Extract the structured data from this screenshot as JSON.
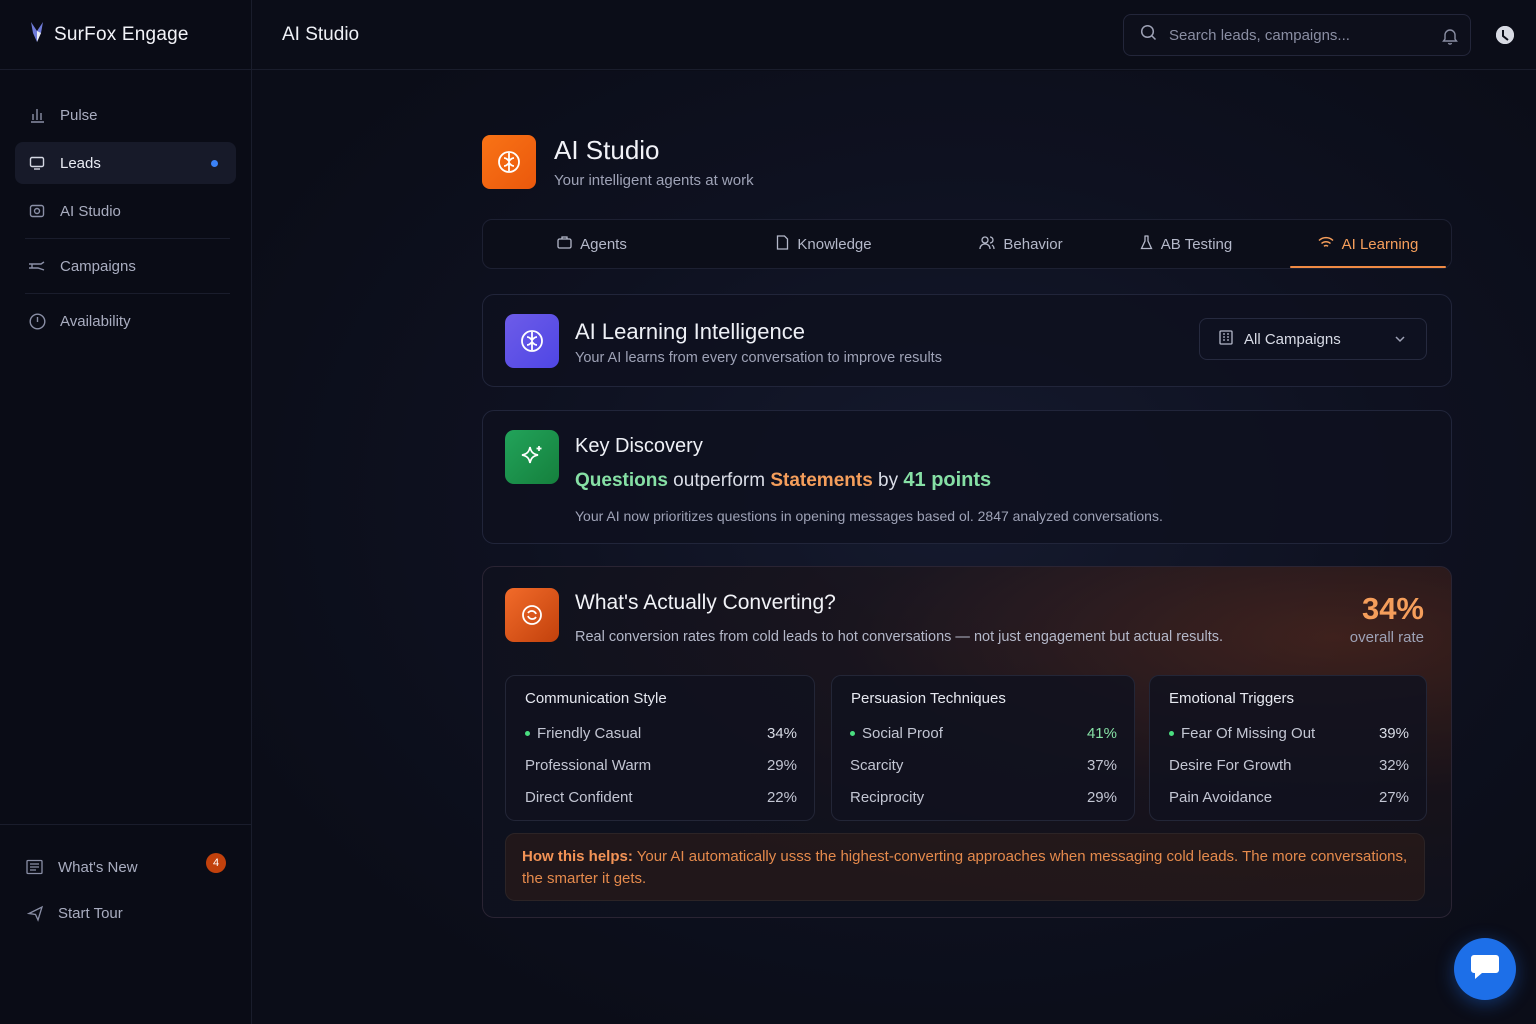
{
  "brand": {
    "name": "SurFox Engage"
  },
  "topbar": {
    "title": "AI Studio",
    "search_placeholder": "Search leads, campaigns..."
  },
  "sidebar": {
    "items": [
      {
        "label": "Pulse",
        "icon": "bar-chart-icon"
      },
      {
        "label": "Leads",
        "icon": "monitor-icon",
        "active": true
      },
      {
        "label": "AI Studio",
        "icon": "ai-box-icon"
      },
      {
        "label": "Campaigns",
        "icon": "campaign-icon"
      },
      {
        "label": "Availability",
        "icon": "clock-icon"
      }
    ],
    "bottom": [
      {
        "label": "What's New",
        "icon": "news-icon",
        "badge": "4"
      },
      {
        "label": "Start Tour",
        "icon": "plane-icon"
      }
    ]
  },
  "page": {
    "title": "AI Studio",
    "subtitle": "Your intelligent agents at work"
  },
  "tabs": [
    {
      "label": "Agents"
    },
    {
      "label": "Knowledge"
    },
    {
      "label": "Behavior"
    },
    {
      "label": "AB Testing"
    },
    {
      "label": "AI Learning",
      "active": true
    }
  ],
  "learning": {
    "title": "AI Learning Intelligence",
    "subtitle": "Your AI learns from every conversation to improve results",
    "dropdown_value": "All Campaigns"
  },
  "discovery": {
    "title": "Key Discovery",
    "w1": "Questions",
    "w2": " outperform ",
    "w3": "Statements",
    "w4": " by ",
    "w5": "41 points",
    "note": "Your AI now prioritizes questions in opening messages based ol. 2847 analyzed conversations."
  },
  "converting": {
    "title": "What's Actually Converting?",
    "subtitle": "Real conversion rates from cold leads to hot conversations — not just engagement but actual results.",
    "rate": "34%",
    "rate_label": "overall rate",
    "panels": [
      {
        "title": "Communication Style",
        "rows": [
          {
            "label": "Friendly Casual",
            "value": "34%"
          },
          {
            "label": "Professional Warm",
            "value": "29%"
          },
          {
            "label": "Direct Confident",
            "value": "22%"
          }
        ]
      },
      {
        "title": "Persuasion Techniques",
        "rows": [
          {
            "label": "Social Proof",
            "value": "41%"
          },
          {
            "label": "Scarcity",
            "value": "37%"
          },
          {
            "label": "Reciprocity",
            "value": "29%"
          }
        ]
      },
      {
        "title": "Emotional Triggers",
        "rows": [
          {
            "label": "Fear Of Missing Out",
            "value": "39%"
          },
          {
            "label": "Desire For Growth",
            "value": "32%"
          },
          {
            "label": "Pain Avoidance",
            "value": "27%"
          }
        ]
      }
    ],
    "helps_label": "How this helps:",
    "helps_text": " Your AI automatically usss the highest-converting approaches when messaging cold leads. The more conversations, the smarter it gets."
  },
  "colors": {
    "accent": "#f59e5b",
    "green": "#86e0a5",
    "blue": "#1d6fe8"
  }
}
